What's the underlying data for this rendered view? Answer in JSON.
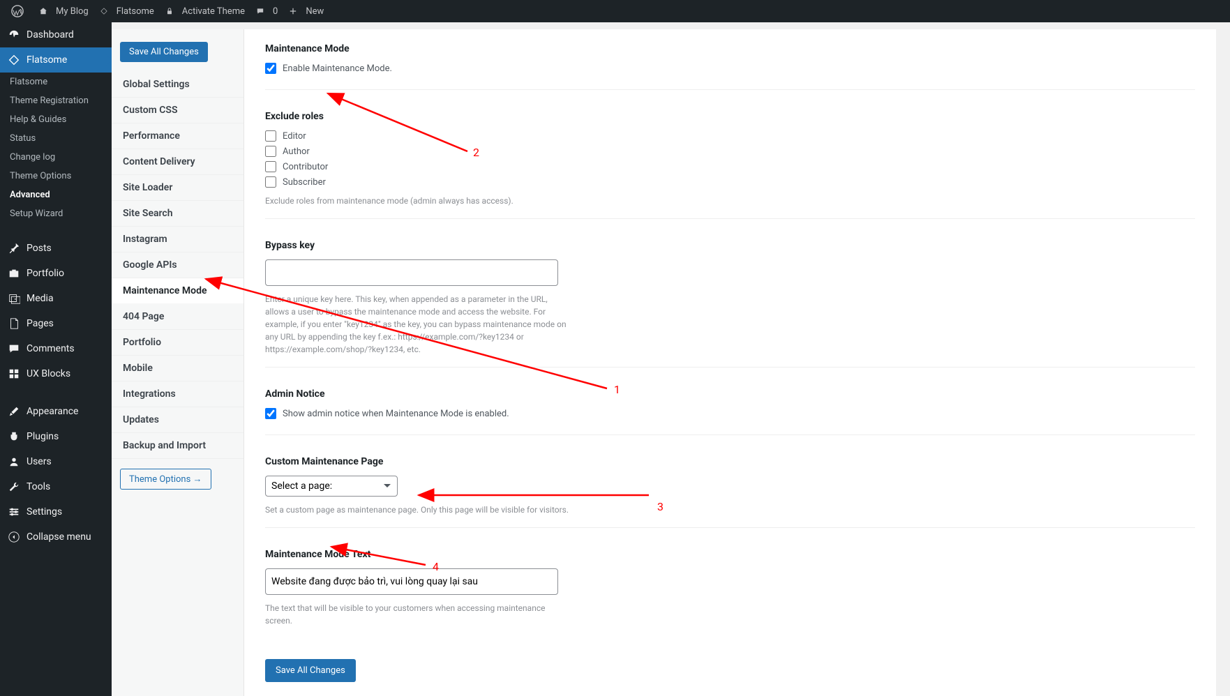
{
  "adminbar": {
    "site_name": "My Blog",
    "theme": "Flatsome",
    "activate": "Activate Theme",
    "comments": "0",
    "new": "New"
  },
  "sidebar": {
    "main": [
      {
        "icon": "dashboard",
        "label": "Dashboard"
      },
      {
        "icon": "flatsome",
        "label": "Flatsome"
      }
    ],
    "sub": [
      "Flatsome",
      "Theme Registration",
      "Help & Guides",
      "Status",
      "Change log",
      "Theme Options",
      "Advanced",
      "Setup Wizard"
    ],
    "after": [
      {
        "icon": "pin",
        "label": "Posts"
      },
      {
        "icon": "grid",
        "label": "Portfolio"
      },
      {
        "icon": "media",
        "label": "Media"
      },
      {
        "icon": "page",
        "label": "Pages"
      },
      {
        "icon": "comment",
        "label": "Comments"
      },
      {
        "icon": "blocks",
        "label": "UX Blocks"
      }
    ],
    "after2": [
      {
        "icon": "brush",
        "label": "Appearance"
      },
      {
        "icon": "plug",
        "label": "Plugins"
      },
      {
        "icon": "user",
        "label": "Users"
      },
      {
        "icon": "wrench",
        "label": "Tools"
      },
      {
        "icon": "sliders",
        "label": "Settings"
      },
      {
        "icon": "collapse",
        "label": "Collapse menu"
      }
    ]
  },
  "subnav": {
    "save": "Save All Changes",
    "items": [
      "Global Settings",
      "Custom CSS",
      "Performance",
      "Content Delivery",
      "Site Loader",
      "Site Search",
      "Instagram",
      "Google APIs",
      "Maintenance Mode",
      "404 Page",
      "Portfolio",
      "Mobile",
      "Integrations",
      "Updates",
      "Backup and Import"
    ],
    "theme_options": "Theme Options →"
  },
  "form": {
    "maintenance_mode": {
      "title": "Maintenance Mode",
      "enable_label": "Enable Maintenance Mode."
    },
    "exclude_roles": {
      "title": "Exclude roles",
      "roles": [
        "Editor",
        "Author",
        "Contributor",
        "Subscriber"
      ],
      "help": "Exclude roles from maintenance mode (admin always has access)."
    },
    "bypass": {
      "title": "Bypass key",
      "value": "",
      "help": "Enter a unique key here. This key, when appended as a parameter in the URL, allows a user to bypass the maintenance mode and access the website. For example, if you enter \"key1234\" as the key, you can bypass maintenance mode on any URL by appending the key f.ex.: https://example.com/?key1234 or https://example.com/shop/?key1234, etc."
    },
    "admin_notice": {
      "title": "Admin Notice",
      "label": "Show admin notice when Maintenance Mode is enabled."
    },
    "custom_page": {
      "title": "Custom Maintenance Page",
      "placeholder": "Select a page:",
      "help": "Set a custom page as maintenance page. Only this page will be visible for visitors."
    },
    "mode_text": {
      "title": "Maintenance Mode Text",
      "value": "Website đang được bảo trì, vui lòng quay lại sau",
      "help": "The text that will be visible to your customers when accessing maintenance screen."
    },
    "save": "Save All Changes"
  },
  "annotations": {
    "1": "1",
    "2": "2",
    "3": "3",
    "4": "4"
  }
}
